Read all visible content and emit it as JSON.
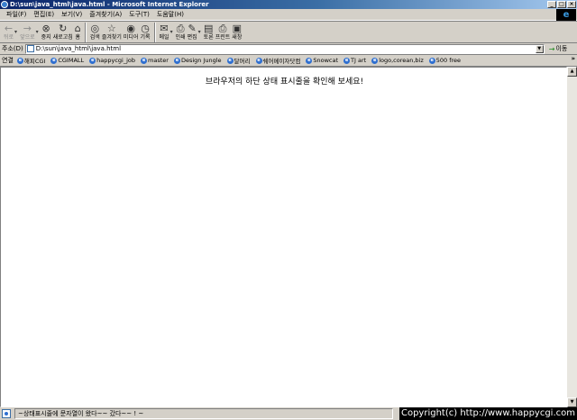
{
  "window": {
    "title": "D:\\sun\\java_html\\java.html - Microsoft Internet Explorer",
    "buttons": [
      "_",
      "□",
      "×"
    ]
  },
  "menu": {
    "items": [
      "파일(F)",
      "편집(E)",
      "보기(V)",
      "즐겨찾기(A)",
      "도구(T)",
      "도움말(H)"
    ]
  },
  "toolbar": {
    "back": "뒤로",
    "forward": "앞으로",
    "stop": "중지",
    "refresh": "새로고침",
    "home": "홈",
    "search": "검색",
    "favorites": "즐겨찾기",
    "media": "미디어",
    "history": "기록",
    "mail": "메일",
    "print": "인쇄",
    "edit": "편집",
    "discuss": "토론",
    "printer": "프린트",
    "messenger": "새창"
  },
  "address": {
    "label": "주소(D)",
    "value": "D:\\sun\\java_html\\java.html",
    "go_label": "이동"
  },
  "links": {
    "label": "연결",
    "items": [
      "해피CGI",
      "CGIMALL",
      "happycgi_job",
      "master",
      "Design Jungle",
      "달머리",
      "쉐어메이자닷컴",
      "Snowcat",
      "TJ art",
      "logo,corean,biz",
      "500 free"
    ],
    "more": "»"
  },
  "content": {
    "message": "브라우저의 하단 상태 표시줄을 확인해 보세요!"
  },
  "status": {
    "text": "~상태표시줄에 문자열이 왔다~~ 갔다~~ ! ~"
  },
  "overlay": {
    "copyright": "Copyright(c) http://www.happycgi.com"
  }
}
